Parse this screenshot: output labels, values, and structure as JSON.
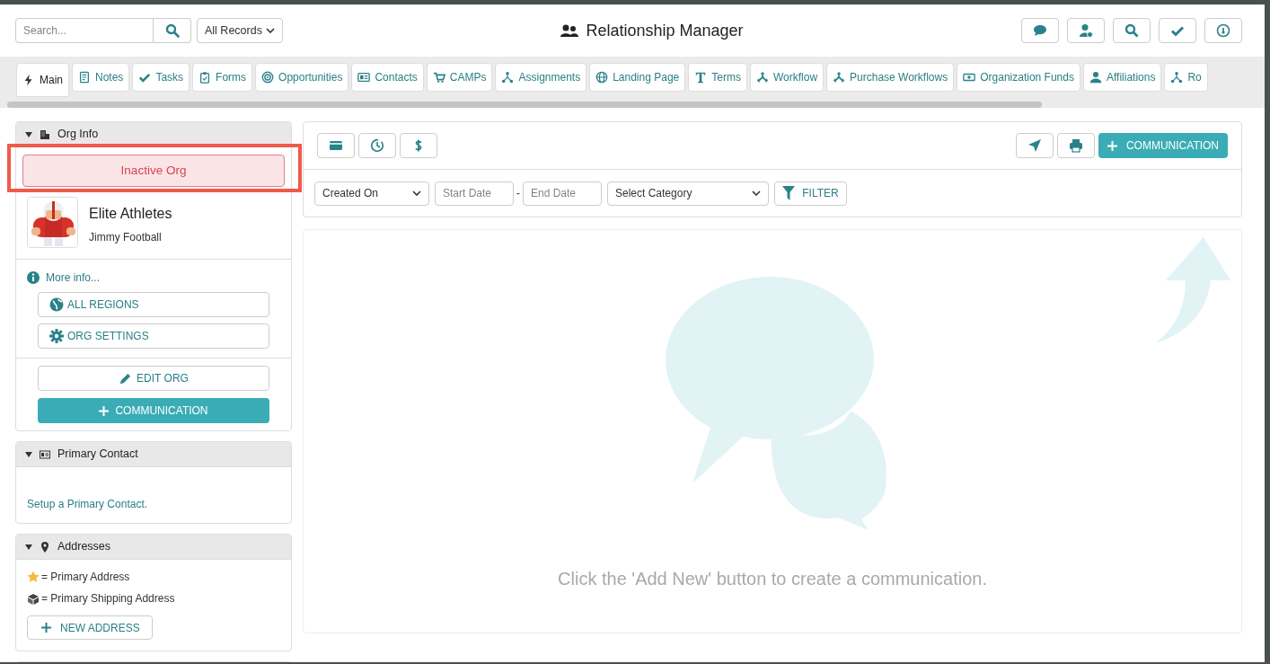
{
  "header": {
    "search": {
      "placeholder": "Search..."
    },
    "record_filter": "All Records",
    "title": "Relationship Manager"
  },
  "tabs": [
    {
      "label": "Main",
      "selected": true
    },
    {
      "label": "Notes",
      "selected": false
    },
    {
      "label": "Tasks",
      "selected": false
    },
    {
      "label": "Forms",
      "selected": false
    },
    {
      "label": "Opportunities",
      "selected": false
    },
    {
      "label": "Contacts",
      "selected": false
    },
    {
      "label": "CAMPs",
      "selected": false
    },
    {
      "label": "Assignments",
      "selected": false
    },
    {
      "label": "Landing Page",
      "selected": false
    },
    {
      "label": "Terms",
      "selected": false
    },
    {
      "label": "Workflow",
      "selected": false
    },
    {
      "label": "Purchase Workflows",
      "selected": false
    },
    {
      "label": "Organization Funds",
      "selected": false
    },
    {
      "label": "Affiliations",
      "selected": false
    },
    {
      "label": "Ro",
      "selected": false
    }
  ],
  "org_info": {
    "title": "Org Info",
    "expanded": true,
    "status": "Inactive Org",
    "highlighted": true,
    "org_name": "Elite Athletes",
    "contact_name": "Jimmy Football",
    "more_info": "More info...",
    "buttons": [
      "ALL REGIONS",
      "ORG SETTINGS"
    ],
    "edit_button": "EDIT ORG",
    "communication_button": "COMMUNICATION"
  },
  "primary_contact": {
    "title": "Primary Contact",
    "expanded": true,
    "link": "Setup a Primary Contact."
  },
  "addresses": {
    "title": "Addresses",
    "expanded": true,
    "legend": [
      "= Primary Address",
      "= Primary Shipping Address"
    ],
    "new_button": "NEW ADDRESS"
  },
  "communications": {
    "add_button": "COMMUNICATION",
    "date_field": "Created On",
    "start_date": {
      "placeholder": "Start Date"
    },
    "separator": "-",
    "end_date": {
      "placeholder": "End Date"
    },
    "category": "Select Category",
    "filter_button": "FILTER",
    "empty_message": "Click the 'Add New' button to create a communication."
  }
}
